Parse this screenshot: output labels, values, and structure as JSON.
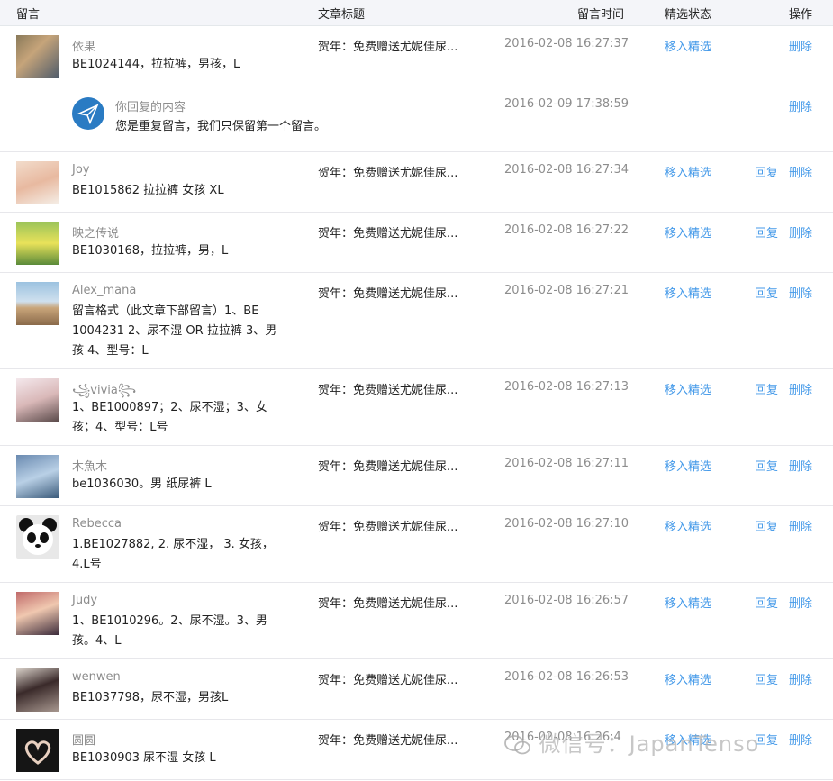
{
  "header": {
    "col_comment": "留言",
    "col_title": "文章标题",
    "col_time": "留言时间",
    "col_featured": "精选状态",
    "col_action": "操作"
  },
  "labels": {
    "move_featured": "移入精选",
    "reply": "回复",
    "delete": "删除"
  },
  "reply_block": {
    "name": "你回复的内容",
    "content": "您是重复留言，我们只保留第一个留言。",
    "time": "2016-02-09 17:38:59"
  },
  "comments": [
    {
      "name": "依果",
      "content": "BE1024144，拉拉裤，男孩，L",
      "title": "贺年：免费赠送尤妮佳尿...",
      "time": "2016-02-08 16:27:37"
    },
    {
      "name": "Joy",
      "content": "BE1015862 拉拉裤 女孩 XL",
      "title": "贺年：免费赠送尤妮佳尿...",
      "time": "2016-02-08 16:27:34"
    },
    {
      "name": "映之传说",
      "content": "BE1030168，拉拉裤，男，L",
      "title": "贺年：免费赠送尤妮佳尿...",
      "time": "2016-02-08 16:27:22"
    },
    {
      "name": "Alex_mana",
      "content": "留言格式（此文章下部留言）1、BE 1004231 2、尿不湿 OR 拉拉裤 3、男孩 4、型号：L",
      "title": "贺年：免费赠送尤妮佳尿...",
      "time": "2016-02-08 16:27:21"
    },
    {
      "name": "꧁vivia꧂",
      "content": "1、BE1000897；2、尿不湿；3、女孩；4、型号：L号",
      "title": "贺年：免费赠送尤妮佳尿...",
      "time": "2016-02-08 16:27:13"
    },
    {
      "name": "木魚木",
      "content": "be1036030。男 纸尿裤 L",
      "title": "贺年：免费赠送尤妮佳尿...",
      "time": "2016-02-08 16:27:11"
    },
    {
      "name": "Rebecca",
      "content": "1.BE1027882, 2. 尿不湿， 3. 女孩， 4.L号",
      "title": "贺年：免费赠送尤妮佳尿...",
      "time": "2016-02-08 16:27:10"
    },
    {
      "name": "Judy",
      "content": "1、BE1010296。2、尿不湿。3、男孩。4、L",
      "title": "贺年：免费赠送尤妮佳尿...",
      "time": "2016-02-08 16:26:57"
    },
    {
      "name": "wenwen",
      "content": "BE1037798，尿不湿，男孩L",
      "title": "贺年：免费赠送尤妮佳尿...",
      "time": "2016-02-08 16:26:53"
    },
    {
      "name": "圆圆",
      "content": "BE1030903 尿不湿 女孩 L",
      "title": "贺年：免费赠送尤妮佳尿...",
      "time": "2016-02-08 16:26:4"
    }
  ],
  "watermark": "微信号：JapanTenso",
  "colors": {
    "link": "#459ae9",
    "muted": "#8d8d8d",
    "header_bg": "#f4f5f9"
  }
}
